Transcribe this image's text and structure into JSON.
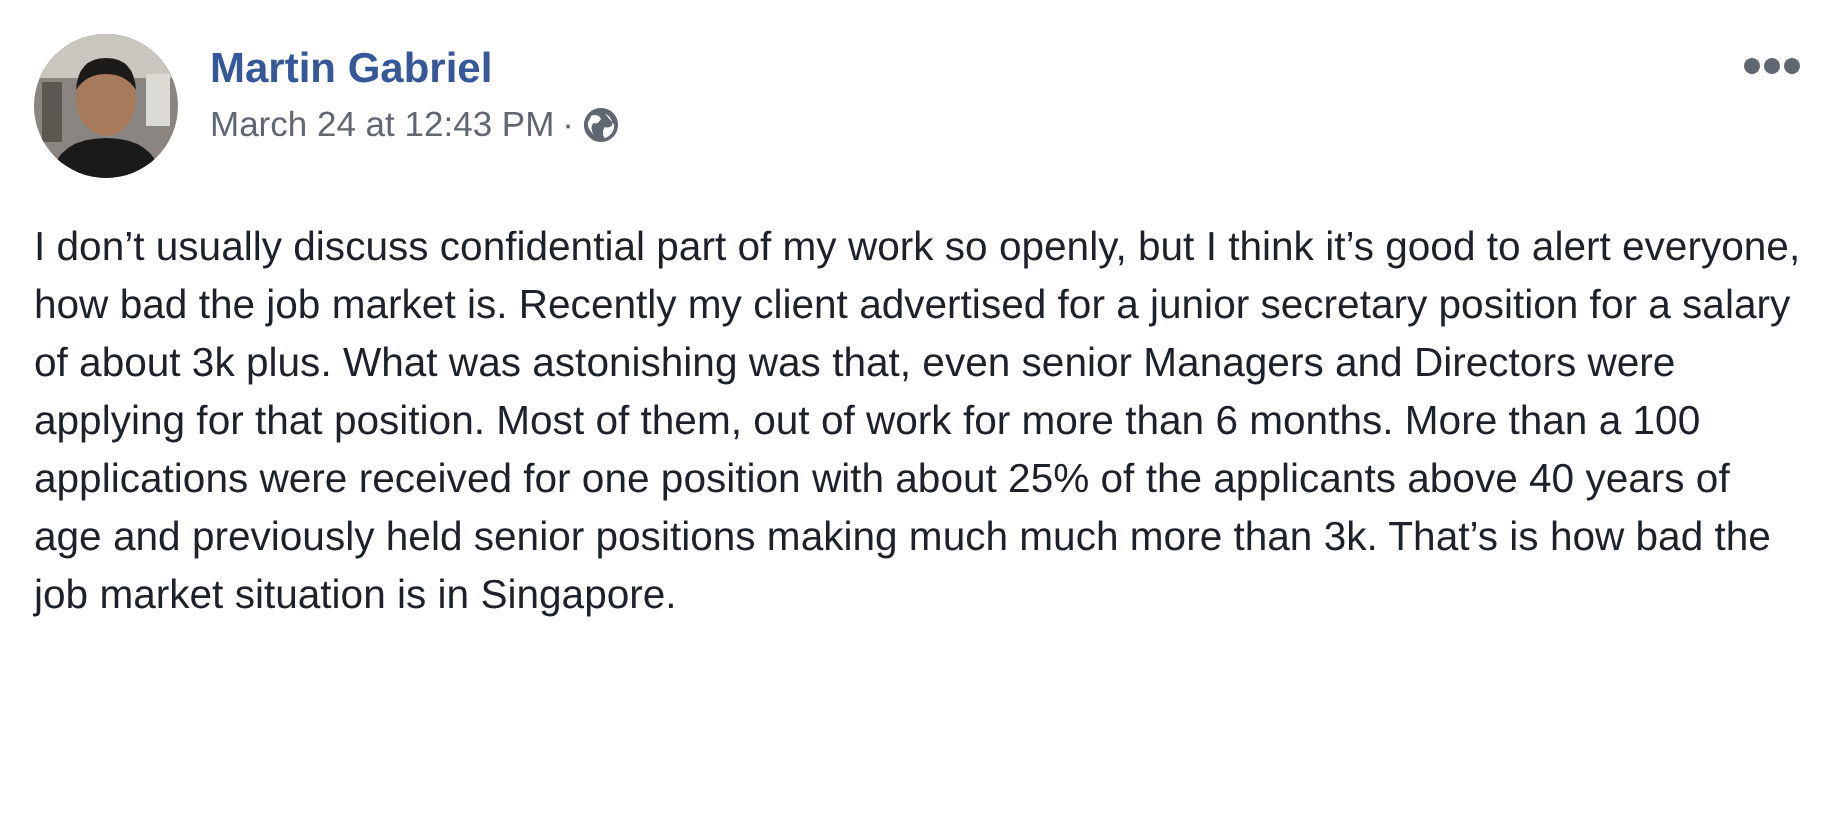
{
  "post": {
    "author": "Martin Gabriel",
    "timestamp": "March 24 at 12:43 PM",
    "separator": "·",
    "text": "I don’t usually discuss confidential part of my work so openly, but I think it’s good to alert everyone, how bad the job market is. Recently my client advertised for a junior secretary position for a salary of about 3k plus. What was astonishing was that, even senior Managers and Directors were applying for that position. Most of them, out of work for more than 6 months. More than a 100 applications were received for one position with about 25% of the applicants above 40 years of age and previously held senior positions making much much more than 3k. That’s is how bad the job market situation is in Singapore."
  }
}
